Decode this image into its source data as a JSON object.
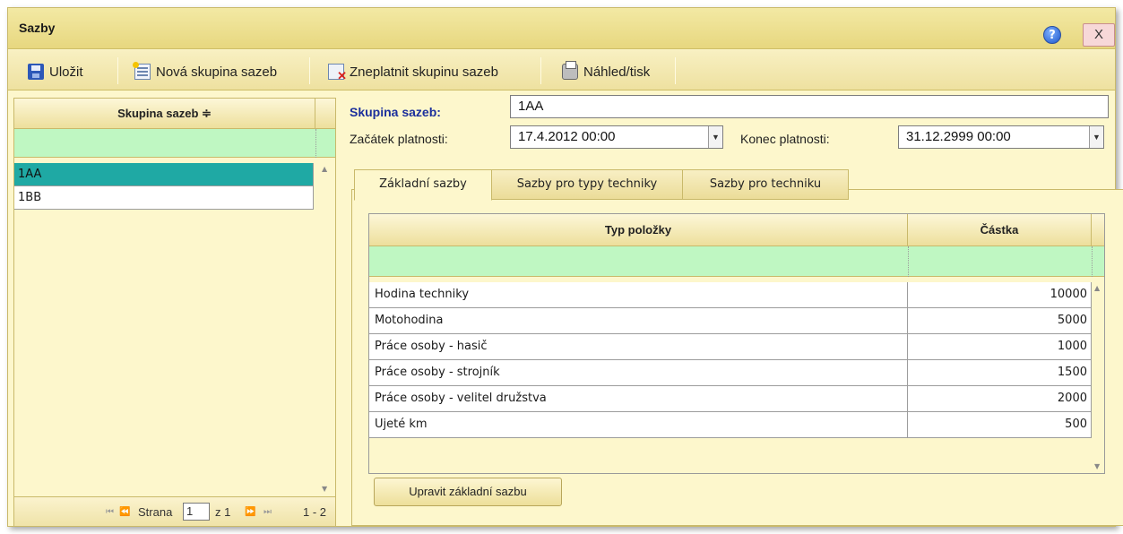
{
  "window": {
    "title": "Sazby",
    "help_label": "?",
    "close_label": "X"
  },
  "toolbar": {
    "save": "Uložit",
    "new_group": "Nová skupina sazeb",
    "invalidate_group": "Zneplatnit skupinu sazeb",
    "preview_print": "Náhled/tisk",
    "icons": [
      "save-icon",
      "new-document-icon",
      "invalidate-icon",
      "printer-icon"
    ]
  },
  "left_grid": {
    "column_header": "Skupina sazeb ≑",
    "rows": [
      "1AA",
      "1BB"
    ],
    "selected_index": 0,
    "pager": {
      "first": "⏮",
      "prev": "⏪",
      "page_label": "Strana",
      "page_value": "1",
      "of_label": "z 1",
      "next": "⏩",
      "last": "⏭",
      "range": "1 - 2"
    }
  },
  "form": {
    "group_label": "Skupina sazeb:",
    "group_value": "1AA",
    "start_label": "Začátek platnosti:",
    "start_value": "17.4.2012 00:00",
    "end_label": "Konec platnosti:",
    "end_value": "31.12.2999 00:00"
  },
  "tabs": [
    {
      "label": "Základní sazby",
      "active": true
    },
    {
      "label": "Sazby pro typy techniky",
      "active": false
    },
    {
      "label": "Sazby pro techniku",
      "active": false
    }
  ],
  "rates_grid": {
    "headers": [
      "Typ položky",
      "Částka"
    ],
    "rows": [
      {
        "type": "Hodina techniky",
        "amount": "10000"
      },
      {
        "type": "Motohodina",
        "amount": "5000"
      },
      {
        "type": "Práce osoby - hasič",
        "amount": "1000"
      },
      {
        "type": "Práce osoby - strojník",
        "amount": "1500"
      },
      {
        "type": "Práce osoby - velitel družstva",
        "amount": "2000"
      },
      {
        "type": "Ujeté km",
        "amount": "500"
      }
    ]
  },
  "edit_button": "Upravit základní sazbu",
  "colors": {
    "panel": "#fdf7cc",
    "filter": "#bff7c2",
    "selected_row": "#1fa9a4",
    "label_blue": "#1b2f9c"
  }
}
